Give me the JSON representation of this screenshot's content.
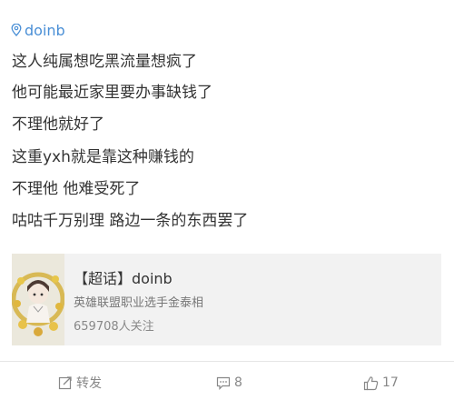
{
  "post": {
    "username": "doinb",
    "lines": [
      "这人纯属想吃黑流量想疯了",
      "他可能最近家里要办事缺钱了",
      "不理他就好了",
      "这重yxh就是靠这种赚钱的",
      "不理他 他难受死了",
      "咕咕千万别理 路边一条的东西罢了"
    ]
  },
  "card": {
    "title": "【超话】doinb",
    "description": "英雄联盟职业选手金泰相",
    "followers": "659708人关注"
  },
  "actions": {
    "repost_label": "转发",
    "comment_count": "8",
    "like_count": "17"
  },
  "colors": {
    "username": "#4a8fd6",
    "card_bg": "#f2f2f2",
    "muted": "#888888"
  },
  "icons": [
    "location-pin-icon",
    "repost-icon",
    "comment-icon",
    "like-icon"
  ]
}
